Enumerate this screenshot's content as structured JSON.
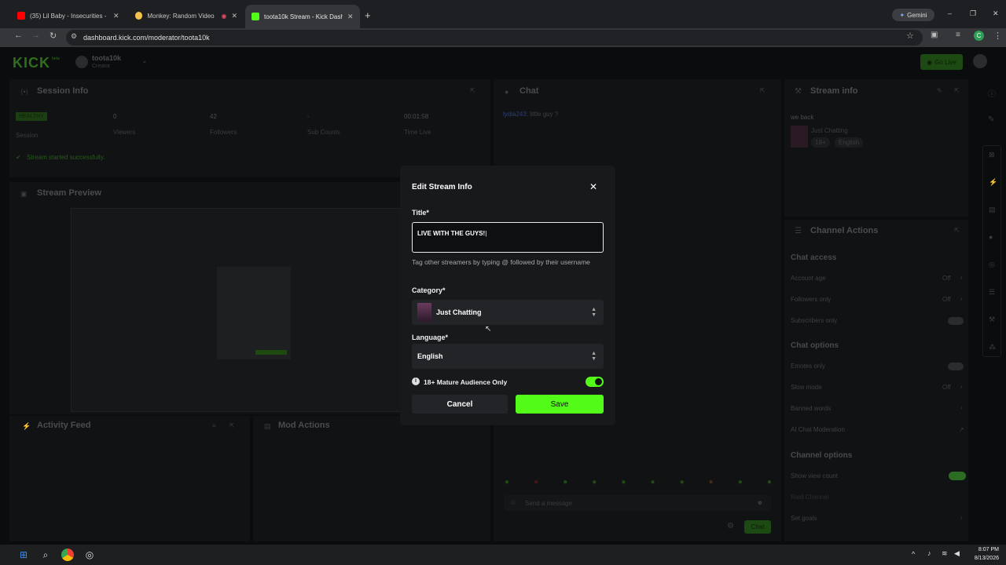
{
  "browser": {
    "tabs": [
      {
        "label": "(35) Lil Baby - Insecurities - You",
        "favicon_color": "#ff0000"
      },
      {
        "label": "Monkey: Random Video Ch",
        "favicon_color": "#f2c14e"
      },
      {
        "label": "toota10k Stream - Kick Dashbo",
        "favicon_color": "#53fc18"
      }
    ],
    "new_tab": "+",
    "url": "dashboard.kick.com/moderator/toota10k",
    "gemini_label": "Gemini",
    "profile_initial": "C",
    "window_controls": [
      "–",
      "❐",
      "✕"
    ]
  },
  "kick": {
    "logo": "KICK",
    "beta": "beta",
    "channel_name": "toota10k",
    "channel_role": "Creator",
    "go_live": "Go Live",
    "session": {
      "title": "Session Info",
      "badge": "HEALTHY",
      "session_label": "Session",
      "stats": [
        {
          "value": "0",
          "label": "Viewers"
        },
        {
          "value": "42",
          "label": "Followers"
        },
        {
          "value": "-",
          "label": "Sub Counts"
        },
        {
          "value": "00:01:58",
          "label": "Time Live"
        }
      ],
      "status": "Stream started successfully."
    },
    "preview_title": "Stream Preview",
    "activity_title": "Activity Feed",
    "mod_title": "Mod Actions",
    "chat": {
      "title": "Chat",
      "message_user": "lydia243",
      "message_text": ": little guy ?",
      "placeholder": "Send a message",
      "send_label": "Chat"
    },
    "stream_info": {
      "title": "Stream info",
      "stream_title": "we back",
      "category": "Just Chatting",
      "tags": [
        "18+",
        "English"
      ]
    },
    "channel_actions": {
      "title": "Channel Actions",
      "chat_access": "Chat access",
      "account_age": "Account age",
      "account_age_value": "Off",
      "followers_only": "Followers only",
      "followers_only_value": "Off",
      "subscribers_only": "Subscribers only",
      "chat_options": "Chat options",
      "emotes_only": "Emotes only",
      "slow_mode": "Slow mode",
      "slow_mode_value": "Off",
      "banned_words": "Banned words",
      "ai_mod": "AI Chat Moderation",
      "channel_options": "Channel options",
      "show_view_count": "Show view count",
      "raid_channel": "Raid Channel",
      "set_goals": "Set goals"
    }
  },
  "modal": {
    "title": "Edit Stream Info",
    "title_label": "Title*",
    "title_value": "LIVE WITH THE GUYS!",
    "hint": "Tag other streamers by typing @ followed by their username",
    "category_label": "Category*",
    "category_value": "Just Chatting",
    "language_label": "Language*",
    "language_value": "English",
    "mature_label": "18+ Mature Audience Only",
    "mature_enabled": true,
    "cancel": "Cancel",
    "save": "Save"
  },
  "taskbar": {
    "time": "8:07 PM",
    "date": "8/13/2026"
  }
}
